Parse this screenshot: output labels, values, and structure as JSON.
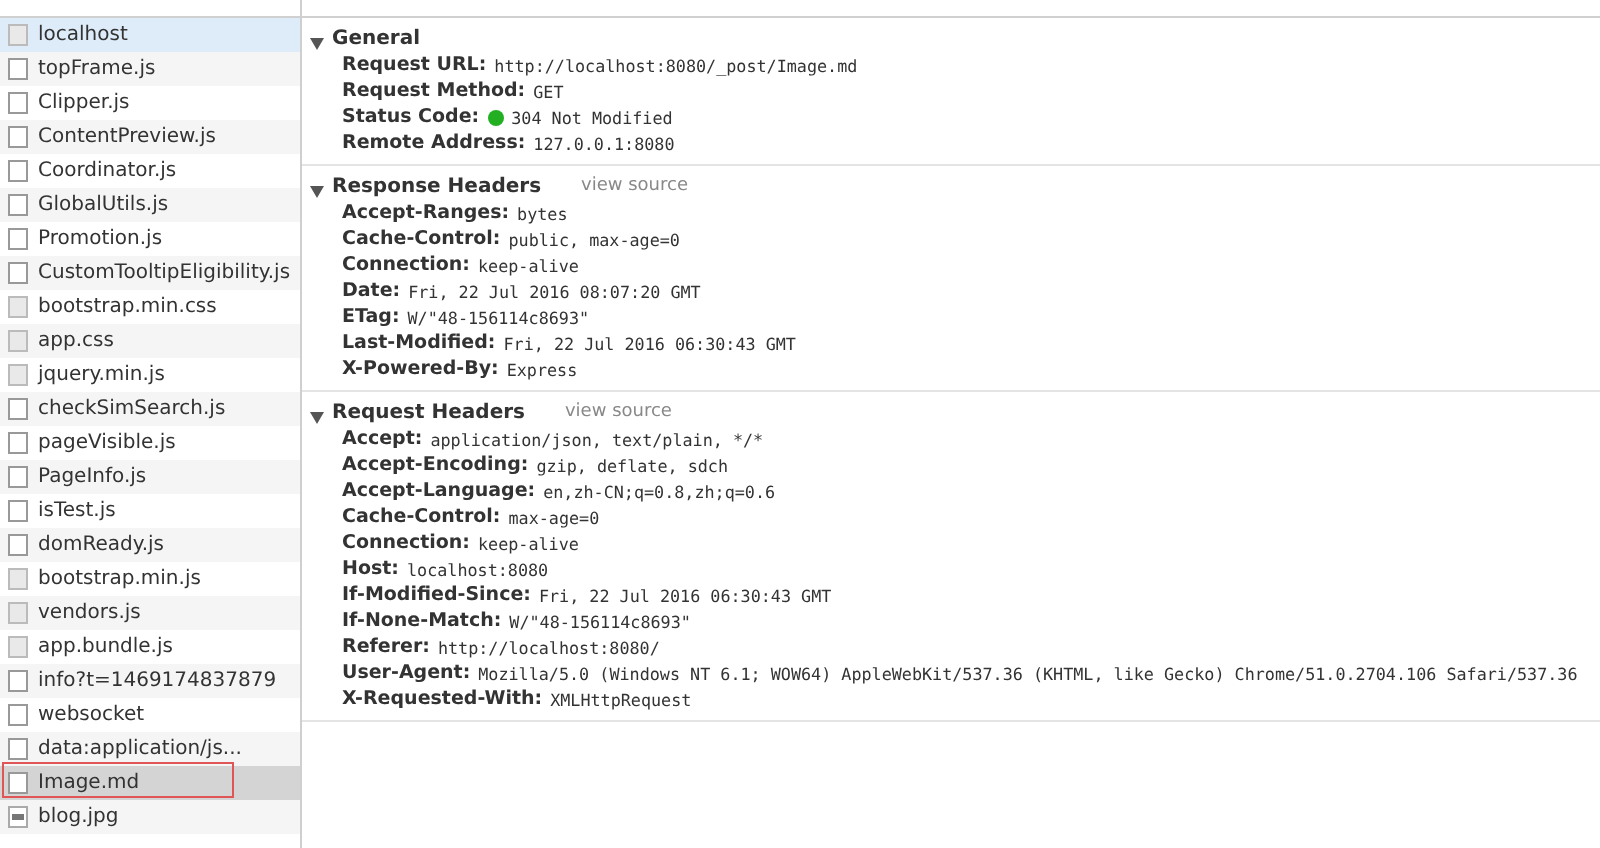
{
  "requests": [
    {
      "name": "localhost",
      "kind": "resource",
      "hover": true,
      "selected": false,
      "outlined": false
    },
    {
      "name": "topFrame.js",
      "kind": "doc",
      "hover": false,
      "selected": false,
      "outlined": false
    },
    {
      "name": "Clipper.js",
      "kind": "doc",
      "hover": false,
      "selected": false,
      "outlined": false
    },
    {
      "name": "ContentPreview.js",
      "kind": "doc",
      "hover": false,
      "selected": false,
      "outlined": false
    },
    {
      "name": "Coordinator.js",
      "kind": "doc",
      "hover": false,
      "selected": false,
      "outlined": false
    },
    {
      "name": "GlobalUtils.js",
      "kind": "doc",
      "hover": false,
      "selected": false,
      "outlined": false
    },
    {
      "name": "Promotion.js",
      "kind": "doc",
      "hover": false,
      "selected": false,
      "outlined": false
    },
    {
      "name": "CustomTooltipEligibility.js",
      "kind": "doc",
      "hover": false,
      "selected": false,
      "outlined": false
    },
    {
      "name": "bootstrap.min.css",
      "kind": "resource",
      "hover": false,
      "selected": false,
      "outlined": false
    },
    {
      "name": "app.css",
      "kind": "resource",
      "hover": false,
      "selected": false,
      "outlined": false
    },
    {
      "name": "jquery.min.js",
      "kind": "resource",
      "hover": false,
      "selected": false,
      "outlined": false
    },
    {
      "name": "checkSimSearch.js",
      "kind": "doc",
      "hover": false,
      "selected": false,
      "outlined": false
    },
    {
      "name": "pageVisible.js",
      "kind": "doc",
      "hover": false,
      "selected": false,
      "outlined": false
    },
    {
      "name": "PageInfo.js",
      "kind": "doc",
      "hover": false,
      "selected": false,
      "outlined": false
    },
    {
      "name": "isTest.js",
      "kind": "doc",
      "hover": false,
      "selected": false,
      "outlined": false
    },
    {
      "name": "domReady.js",
      "kind": "doc",
      "hover": false,
      "selected": false,
      "outlined": false
    },
    {
      "name": "bootstrap.min.js",
      "kind": "resource",
      "hover": false,
      "selected": false,
      "outlined": false
    },
    {
      "name": "vendors.js",
      "kind": "resource",
      "hover": false,
      "selected": false,
      "outlined": false
    },
    {
      "name": "app.bundle.js",
      "kind": "resource",
      "hover": false,
      "selected": false,
      "outlined": false
    },
    {
      "name": "info?t=1469174837879",
      "kind": "doc",
      "hover": false,
      "selected": false,
      "outlined": false
    },
    {
      "name": "websocket",
      "kind": "doc",
      "hover": false,
      "selected": false,
      "outlined": false
    },
    {
      "name": "data:application/js...",
      "kind": "doc",
      "hover": false,
      "selected": false,
      "outlined": false
    },
    {
      "name": "Image.md",
      "kind": "doc",
      "hover": false,
      "selected": true,
      "outlined": true
    },
    {
      "name": "blog.jpg",
      "kind": "image",
      "hover": false,
      "selected": false,
      "outlined": false
    }
  ],
  "sections": [
    {
      "title": "General",
      "expanded": true,
      "rows": [
        {
          "key": "Request URL:",
          "value": "http://localhost:8080/_post/Image.md"
        },
        {
          "key": "Request Method:",
          "value": "GET"
        },
        {
          "key": "Status Code:",
          "value": "304 Not Modified",
          "color": "#22b022"
        },
        {
          "key": "Remote Address:",
          "value": "127.0.0.1:8080"
        }
      ]
    },
    {
      "title": "Response Headers",
      "link": "view source",
      "expanded": true,
      "rows": [
        {
          "key": "Accept-Ranges:",
          "value": "bytes"
        },
        {
          "key": "Cache-Control:",
          "value": "public, max-age=0"
        },
        {
          "key": "Connection:",
          "value": "keep-alive"
        },
        {
          "key": "Date:",
          "value": "Fri, 22 Jul 2016 08:07:20 GMT"
        },
        {
          "key": "ETag:",
          "value": "W/\"48-156114c8693\""
        },
        {
          "key": "Last-Modified:",
          "value": "Fri, 22 Jul 2016 06:30:43 GMT"
        },
        {
          "key": "X-Powered-By:",
          "value": "Express"
        }
      ]
    },
    {
      "title": "Request Headers",
      "link": "view source",
      "expanded": true,
      "rows": [
        {
          "key": "Accept:",
          "value": "application/json, text/plain, */*"
        },
        {
          "key": "Accept-Encoding:",
          "value": "gzip, deflate, sdch"
        },
        {
          "key": "Accept-Language:",
          "value": "en,zh-CN;q=0.8,zh;q=0.6"
        },
        {
          "key": "Cache-Control:",
          "value": "max-age=0"
        },
        {
          "key": "Connection:",
          "value": "keep-alive"
        },
        {
          "key": "Host:",
          "value": "localhost:8080"
        },
        {
          "key": "If-Modified-Since:",
          "value": "Fri, 22 Jul 2016 06:30:43 GMT"
        },
        {
          "key": "If-None-Match:",
          "value": "W/\"48-156114c8693\""
        },
        {
          "key": "Referer:",
          "value": "http://localhost:8080/"
        },
        {
          "key": "User-Agent:",
          "value": "Mozilla/5.0 (Windows NT 6.1; WOW64) AppleWebKit/537.36 (KHTML, like Gecko) Chrome/51.0.2704.106 Safari/537.36"
        },
        {
          "key": "X-Requested-With:",
          "value": "XMLHttpRequest"
        }
      ]
    }
  ]
}
